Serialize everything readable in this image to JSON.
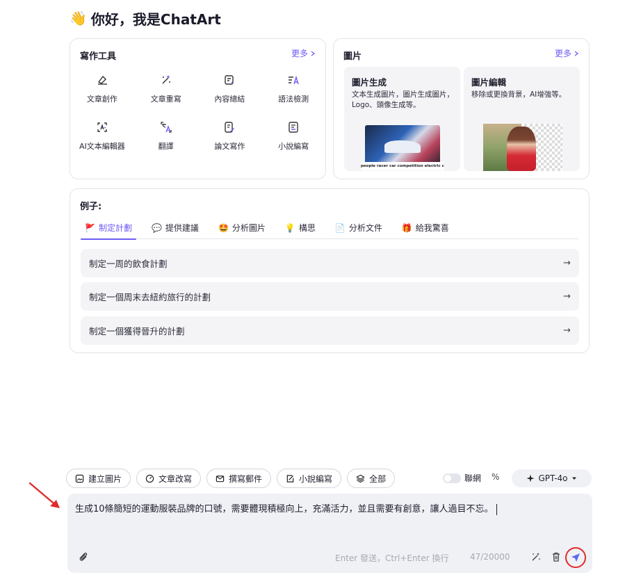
{
  "greeting": {
    "emoji": "👋",
    "title": "你好，我是ChatArt"
  },
  "tools": {
    "title": "寫作工具",
    "more": "更多",
    "items": [
      {
        "label": "文章創作",
        "icon": "pen-nib-icon"
      },
      {
        "label": "文章重寫",
        "icon": "magic-wand-icon"
      },
      {
        "label": "內容總結",
        "icon": "summary-doc-icon"
      },
      {
        "label": "語法檢測",
        "icon": "grammar-check-icon"
      },
      {
        "label": "AI文本編輯器",
        "icon": "ai-editor-icon"
      },
      {
        "label": "翻譯",
        "icon": "translate-icon"
      },
      {
        "label": "論文寫作",
        "icon": "paper-edit-icon"
      },
      {
        "label": "小說編寫",
        "icon": "novel-book-icon"
      }
    ]
  },
  "images": {
    "title": "圖片",
    "more": "更多",
    "generate": {
      "title": "圖片生成",
      "desc": "文本生成圖片，圖片生成圖片，Logo、頭像生成等。",
      "caption": "people racer car competition electric car"
    },
    "edit": {
      "title": "圖片編輯",
      "desc": "移除或更換背景，AI增強等。"
    }
  },
  "examples": {
    "title": "例子:",
    "tabs": [
      {
        "label": "制定計劃",
        "emoji": "🚩",
        "active": true
      },
      {
        "label": "提供建議",
        "emoji": "💬"
      },
      {
        "label": "分析圖片",
        "emoji": "🤩"
      },
      {
        "label": "構思",
        "emoji": "💡"
      },
      {
        "label": "分析文件",
        "emoji": "📄"
      },
      {
        "label": "給我驚喜",
        "emoji": "🎁"
      }
    ],
    "items": [
      {
        "text": "制定一周的飲食計劃",
        "arrow": "→"
      },
      {
        "text": "制定一個周末去紐約旅行的計劃",
        "arrow": "→"
      },
      {
        "text": "制定一個獲得晉升的計劃",
        "arrow": "→"
      }
    ]
  },
  "composer": {
    "chips": [
      {
        "label": "建立圖片",
        "icon": "image-icon"
      },
      {
        "label": "文章改寫",
        "icon": "gauge-icon"
      },
      {
        "label": "撰寫郵件",
        "icon": "mail-icon"
      },
      {
        "label": "小說編寫",
        "icon": "note-edit-icon"
      },
      {
        "label": "全部",
        "icon": "layers-icon"
      }
    ],
    "network_label": "聯網",
    "network_on": false,
    "percent_label": "%",
    "model": "GPT-4o",
    "input_text": "生成10條簡短的運動服裝品牌的口號，需要體現積極向上，充滿活力，並且需要有創意，讓人過目不忘。",
    "hint": "Enter 發送，Ctrl+Enter 換行",
    "counter": "47/20000"
  },
  "colors": {
    "accent": "#6d5cf5",
    "annotation": "#e12b2b"
  }
}
